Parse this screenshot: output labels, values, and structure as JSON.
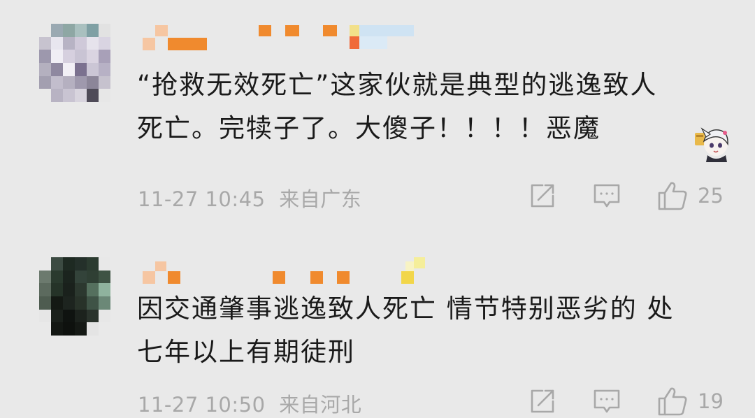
{
  "comments": [
    {
      "text_lines": [
        "“抢救无效死亡”这家伙就是典型的逃逸致人",
        "死亡。完犊子了。大傻子！！！！恶魔"
      ],
      "time": "11-27 10:45",
      "location": "来自广东",
      "likes": "25",
      "icons": {
        "share": "share-icon",
        "comment": "comment-icon",
        "like": "thumbs-up-icon"
      },
      "sticker": "anime-girl-sticker"
    },
    {
      "text_lines": [
        "因交通肇事逃逸致人死亡 情节特别恶劣的 处",
        "七年以上有期徒刑"
      ],
      "time": "11-27 10:50",
      "location": "来自河北",
      "likes": "19",
      "icons": {
        "share": "share-icon",
        "comment": "comment-icon",
        "like": "thumbs-up-icon"
      }
    }
  ],
  "colors": {
    "background": "#e9e9e9",
    "text": "#1a1a1a",
    "meta": "#a8a8a8",
    "censor_orange": "#f08a2e",
    "censor_peach": "#f6c6a2",
    "censor_yellow": "#f2d64a",
    "censor_blue": "#cfe3f3"
  }
}
